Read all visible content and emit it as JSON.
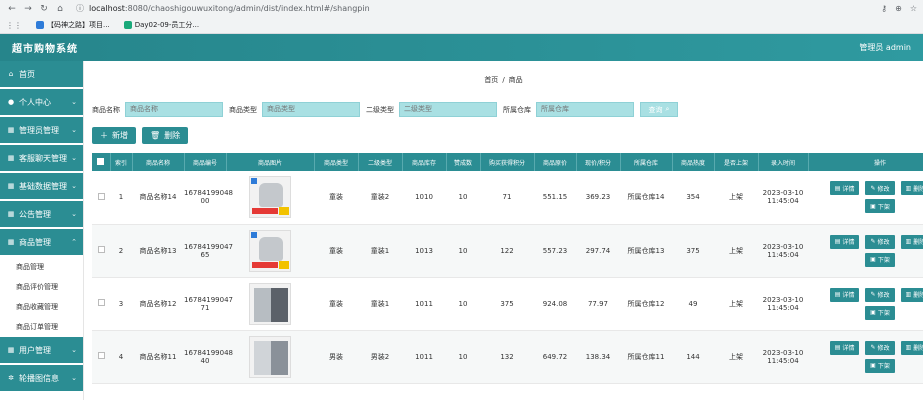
{
  "browser": {
    "url_host": "localhost",
    "url_path": ":8080/chaoshigouwuxitong/admin/dist/index.html#/shangpin",
    "bookmarks": [
      "【码神之路】项目...",
      "Day02-09-员工分..."
    ]
  },
  "header": {
    "title": "超市购物系统",
    "user": "管理员 admin"
  },
  "sidebar": {
    "items": [
      {
        "label": "首页",
        "icon": "home-icon"
      },
      {
        "label": "个人中心",
        "icon": "user-icon"
      },
      {
        "label": "管理员管理",
        "icon": "grid-icon"
      },
      {
        "label": "客服聊天管理",
        "icon": "grid-icon"
      },
      {
        "label": "基础数据管理",
        "icon": "grid-icon"
      },
      {
        "label": "公告管理",
        "icon": "grid-icon"
      },
      {
        "label": "商品管理",
        "icon": "grid-icon"
      }
    ],
    "sub_items": [
      "商品管理",
      "商品评价管理",
      "商品收藏管理",
      "商品订单管理"
    ],
    "bottom_items": [
      {
        "label": "用户管理",
        "icon": "grid-icon"
      },
      {
        "label": "轮播图信息",
        "icon": "gear-icon"
      }
    ]
  },
  "breadcrumb": {
    "home": "首页",
    "sep": "/",
    "current": "商品"
  },
  "search": {
    "name_label": "商品名称",
    "name_placeholder": "商品名称",
    "type_label": "商品类型",
    "type_placeholder": "商品类型",
    "sub_label": "二级类型",
    "sub_placeholder": "二级类型",
    "warehouse_label": "所属仓库",
    "warehouse_placeholder": "所属仓库",
    "button": "查询"
  },
  "actions": {
    "add": "新增",
    "delete": "删除"
  },
  "table": {
    "headers": [
      "索引",
      "商品名称",
      "商品编号",
      "商品图片",
      "商品类型",
      "二级类型",
      "商品库存",
      "赞成数",
      "购买获得积分",
      "商品原价",
      "现价/积分",
      "所属仓库",
      "商品热度",
      "是否上架",
      "录入时间",
      "操作"
    ],
    "rows": [
      {
        "idx": "1",
        "name": "商品名称14",
        "code": "16784199048 00",
        "type": "童装",
        "sub": "童装2",
        "stock": "1010",
        "likes": "10",
        "points": "71",
        "price": "551.15",
        "now": "369.23",
        "warehouse": "所属仓库14",
        "heat": "354",
        "shelf": "上架",
        "time": "2023-03-10 11:45:04"
      },
      {
        "idx": "2",
        "name": "商品名称13",
        "code": "16784199047 65",
        "type": "童装",
        "sub": "童装1",
        "stock": "1013",
        "likes": "10",
        "points": "122",
        "price": "557.23",
        "now": "297.74",
        "warehouse": "所属仓库13",
        "heat": "375",
        "shelf": "上架",
        "time": "2023-03-10 11:45:04"
      },
      {
        "idx": "3",
        "name": "商品名称12",
        "code": "16784199047 71",
        "type": "童装",
        "sub": "童装1",
        "stock": "1011",
        "likes": "10",
        "points": "375",
        "price": "924.08",
        "now": "77.97",
        "warehouse": "所属仓库12",
        "heat": "49",
        "shelf": "上架",
        "time": "2023-03-10 11:45:04"
      },
      {
        "idx": "4",
        "name": "商品名称11",
        "code": "16784199048 40",
        "type": "男装",
        "sub": "男装2",
        "stock": "1011",
        "likes": "10",
        "points": "132",
        "price": "649.72",
        "now": "138.34",
        "warehouse": "所属仓库11",
        "heat": "144",
        "shelf": "上架",
        "time": "2023-03-10 11:45:04"
      }
    ],
    "ops": {
      "detail": "详情",
      "edit": "修改",
      "delete": "删除",
      "off": "下架"
    }
  }
}
